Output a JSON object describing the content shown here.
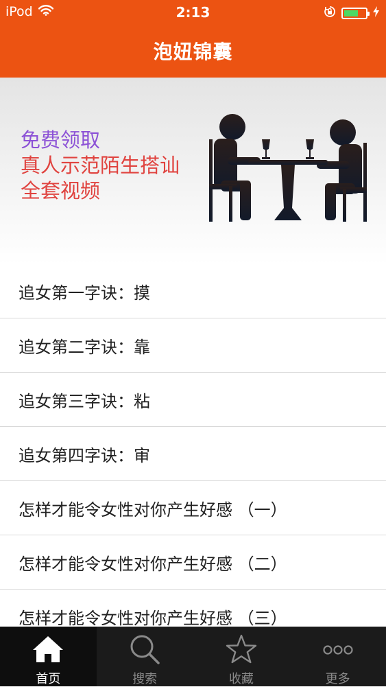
{
  "status_bar": {
    "carrier": "iPod",
    "time": "2:13"
  },
  "nav": {
    "title": "泡妞锦囊"
  },
  "banner": {
    "line1": "免费领取",
    "line2": "真人示范陌生搭讪",
    "line3": "全套视频"
  },
  "list": {
    "items": [
      {
        "title": "追女第一字诀：摸"
      },
      {
        "title": "追女第二字诀：靠"
      },
      {
        "title": "追女第三字诀：粘"
      },
      {
        "title": "追女第四字诀：审"
      },
      {
        "title": "怎样才能令女性对你产生好感 （一）"
      },
      {
        "title": "怎样才能令女性对你产生好感 （二）"
      },
      {
        "title": "怎样才能令女性对你产生好感 （三）"
      }
    ]
  },
  "tabbar": {
    "tabs": [
      {
        "label": "首页",
        "icon": "home-icon",
        "active": true
      },
      {
        "label": "搜索",
        "icon": "search-icon",
        "active": false
      },
      {
        "label": "收藏",
        "icon": "star-icon",
        "active": false
      },
      {
        "label": "更多",
        "icon": "more-icon",
        "active": false
      }
    ]
  },
  "colors": {
    "accent": "#ec5312",
    "tabbar": "#1b1b1b",
    "battery": "#4cd964"
  }
}
